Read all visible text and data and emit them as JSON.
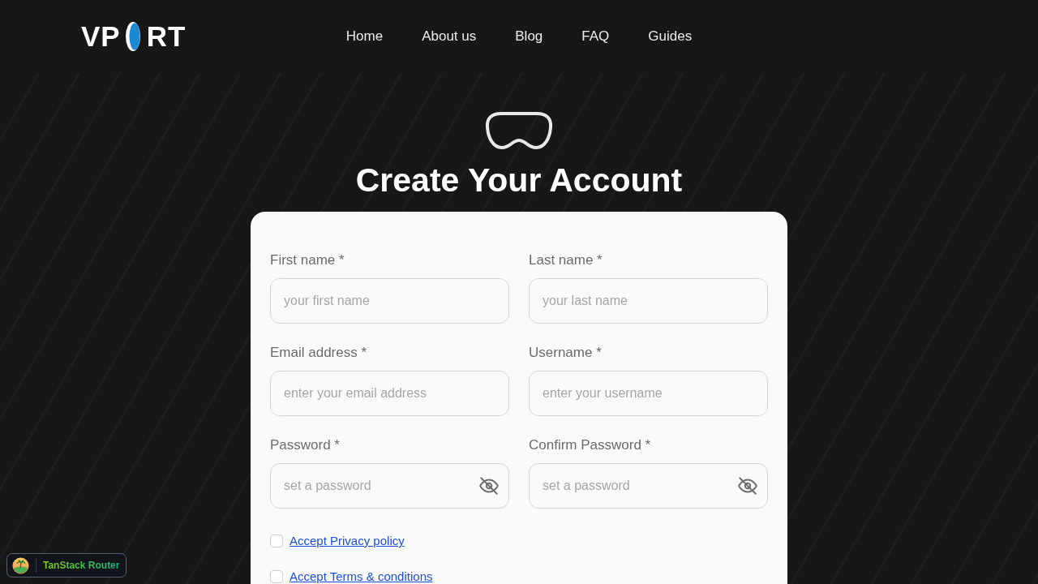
{
  "header": {
    "logo": {
      "left": "VP",
      "right": "RT"
    },
    "nav": [
      {
        "label": "Home"
      },
      {
        "label": "About us"
      },
      {
        "label": "Blog"
      },
      {
        "label": "FAQ"
      },
      {
        "label": "Guides"
      }
    ]
  },
  "hero": {
    "title": "Create Your Account"
  },
  "form": {
    "fields": [
      {
        "kind": "text",
        "label": "First name *",
        "placeholder": "your first name"
      },
      {
        "kind": "text",
        "label": "Last name *",
        "placeholder": "your last name"
      },
      {
        "kind": "text",
        "label": "Email address *",
        "placeholder": "enter your email address"
      },
      {
        "kind": "text",
        "label": "Username *",
        "placeholder": "enter your username"
      },
      {
        "kind": "password",
        "label": "Password *",
        "placeholder": "set a password"
      },
      {
        "kind": "password",
        "label": "Confirm Password *",
        "placeholder": "set a password"
      }
    ],
    "checkboxes": [
      {
        "label": "Accept Privacy policy",
        "checked": false
      },
      {
        "label": "Accept Terms & conditions",
        "checked": false
      }
    ]
  },
  "devtools_badge": {
    "label": "TanStack Router"
  }
}
